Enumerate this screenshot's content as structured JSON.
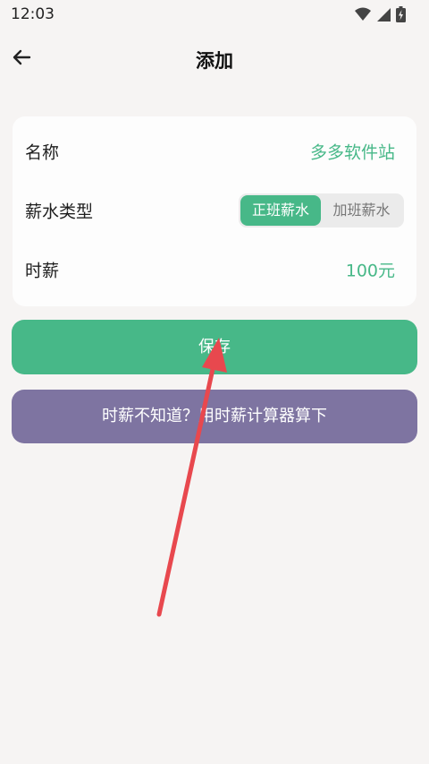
{
  "status_bar": {
    "time": "12:03",
    "icons": [
      "wifi-icon",
      "signal-icon",
      "battery-charging-icon"
    ]
  },
  "header": {
    "title": "添加",
    "back_icon": "back-arrow-icon"
  },
  "form": {
    "name": {
      "label": "名称",
      "value": "多多软件站"
    },
    "salary_type": {
      "label": "薪水类型",
      "options": [
        "正班薪水",
        "加班薪水"
      ],
      "selected": "正班薪水"
    },
    "hourly_wage": {
      "label": "时薪",
      "value": "100元"
    }
  },
  "buttons": {
    "save": "保存",
    "calculator": "时薪不知道？用时薪计算器算下"
  },
  "colors": {
    "accent_green": "#47b888",
    "button_purple": "#7e74a1",
    "annotation_arrow": "#e8484e",
    "background": "#f6f4f3"
  }
}
